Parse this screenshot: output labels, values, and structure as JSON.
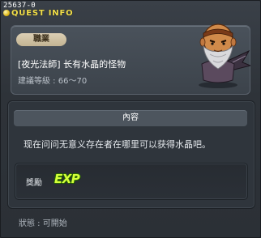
{
  "header": {
    "quest_id": "25637-0",
    "title": "QUEST INFO"
  },
  "quest": {
    "job_tag": "職業",
    "name": "[夜光法師] 长有水晶的怪物",
    "level_range": "建議等級 : 66～70",
    "portrait_icon": "bearded-monster-portrait"
  },
  "content": {
    "header": "內容",
    "text": "现在问问无意义存在者在哪里可以获得水晶吧。"
  },
  "reward": {
    "label": "獎勵",
    "exp_label": "EXP"
  },
  "status": {
    "text": "狀態 : 可開始"
  },
  "colors": {
    "title": "#f3e04a",
    "exp": "#d4ff3a",
    "background": "#2c3138"
  }
}
